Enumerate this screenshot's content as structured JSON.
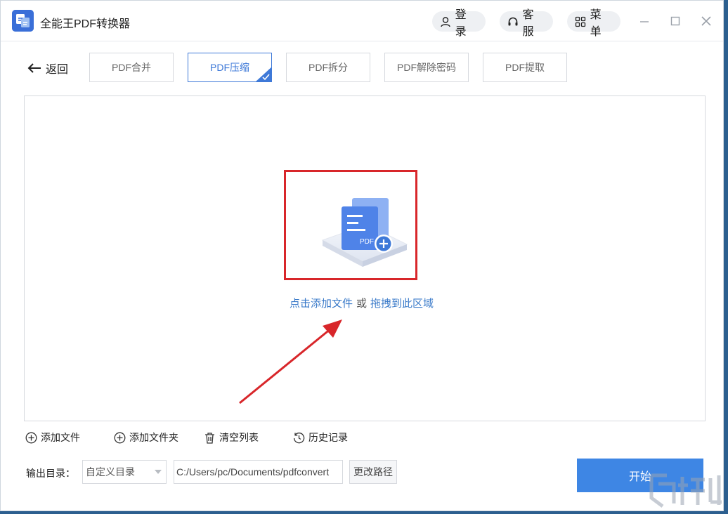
{
  "app": {
    "title": "全能王PDF转换器"
  },
  "header": {
    "login_label": "登录",
    "service_label": "客服",
    "menu_label": "菜单"
  },
  "nav": {
    "back_label": "返回",
    "tabs": [
      {
        "label": "PDF合并",
        "active": false
      },
      {
        "label": "PDF压缩",
        "active": true
      },
      {
        "label": "PDF拆分",
        "active": false
      },
      {
        "label": "PDF解除密码",
        "active": false
      },
      {
        "label": "PDF提取",
        "active": false
      }
    ]
  },
  "dropzone": {
    "illustration_text": "PDF",
    "click_text": "点击添加文件",
    "or_text": "或",
    "drag_text": "拖拽到此区域"
  },
  "toolbar": {
    "add_file_label": "添加文件",
    "add_folder_label": "添加文件夹",
    "clear_label": "清空列表",
    "history_label": "历史记录"
  },
  "output": {
    "label": "输出目录：",
    "mode_value": "自定义目录",
    "path_value": "C:/Users/pc/Documents/pdfconvert",
    "change_label": "更改路径"
  },
  "start_label": "开始",
  "colors": {
    "accent": "#3e79d8",
    "start_button": "#3e86e4",
    "annotation_red": "#d8262a",
    "link_blue": "#3a7ac9"
  }
}
